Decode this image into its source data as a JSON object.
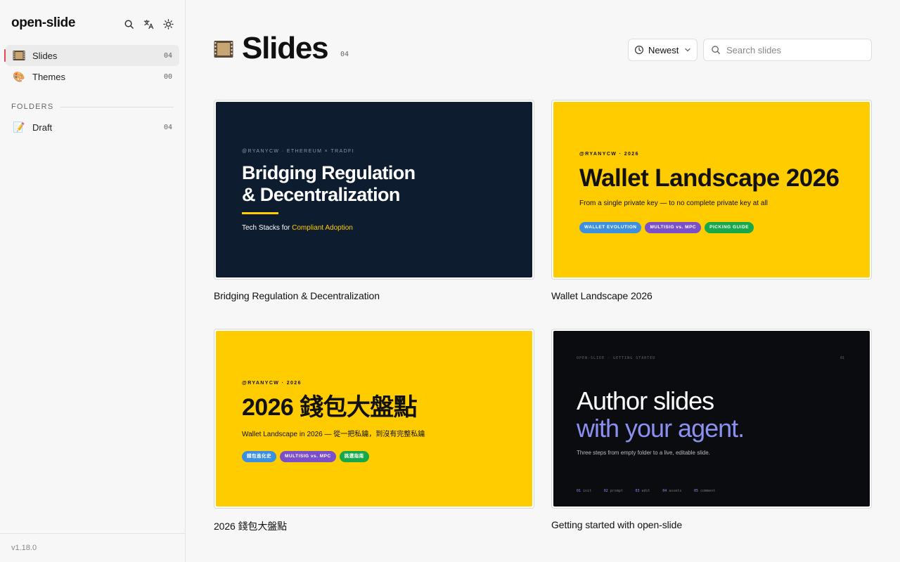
{
  "sidebar": {
    "brand": "open-slide",
    "icons": [
      "search-icon",
      "translate-icon",
      "sun-icon"
    ],
    "nav": [
      {
        "label": "Slides",
        "count": "04",
        "emoji": "🎞️",
        "active": true
      },
      {
        "label": "Themes",
        "count": "00",
        "emoji": "🎨",
        "active": false
      }
    ],
    "folders_heading": "FOLDERS",
    "folders": [
      {
        "label": "Draft",
        "count": "04",
        "emoji": "📝"
      }
    ],
    "version": "v1.18.0"
  },
  "header": {
    "title": "Slides",
    "count": "04",
    "sort_label": "Newest",
    "search_placeholder": "Search slides"
  },
  "cards": [
    {
      "title": "Bridging Regulation & Decentralization",
      "thumb": {
        "kicker": "@RYANYCW · ETHEREUM × TRADFI",
        "line1": "Bridging Regulation",
        "line2": "& Decentralization",
        "sub_prefix": "Tech Stacks for ",
        "sub_highlight": "Compliant Adoption",
        "accent": "#ffcc00"
      }
    },
    {
      "title": "Wallet Landscape 2026",
      "thumb": {
        "kicker": "@RYANYCW · 2026",
        "heading": "Wallet Landscape 2026",
        "sub": "From a single private key — to no complete private key at all",
        "tags": [
          "WALLET EVOLUTION",
          "MULTISIG vs. MPC",
          "PICKING GUIDE"
        ]
      }
    },
    {
      "title": "2026 錢包大盤點",
      "thumb": {
        "kicker": "@RYANYCW · 2026",
        "heading": "2026 錢包大盤點",
        "sub": "Wallet Landscape in 2026 — 從一把私鑰，到沒有完整私鑰",
        "tags": [
          "錢包進化史",
          "MULTISIG vs. MPC",
          "挑選指南"
        ]
      }
    },
    {
      "title": "Getting started with open-slide",
      "thumb": {
        "kicker": "OPEN-SLIDE · GETTING STARTED",
        "page": "01",
        "line1": "Author slides",
        "line2": "with your agent.",
        "sub": "Three steps from empty folder to a live, editable slide.",
        "steps": [
          {
            "n": "01",
            "t": "init"
          },
          {
            "n": "02",
            "t": "prompt"
          },
          {
            "n": "03",
            "t": "edit"
          },
          {
            "n": "04",
            "t": "assets"
          },
          {
            "n": "05",
            "t": "comment"
          }
        ]
      }
    }
  ]
}
